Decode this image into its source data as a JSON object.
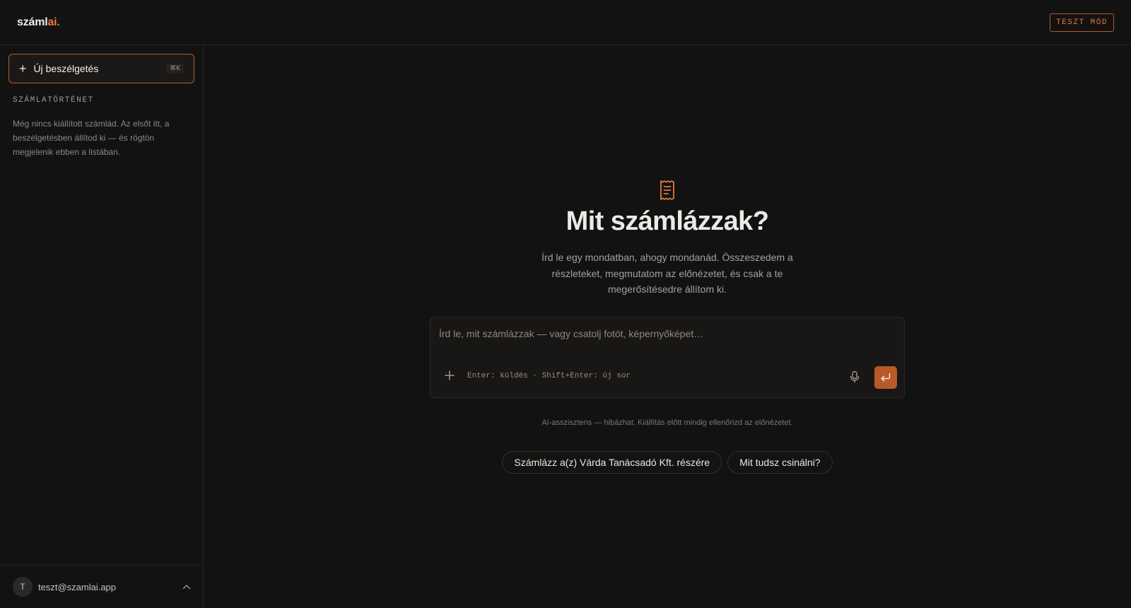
{
  "header": {
    "logo_text": "száml",
    "logo_accent": "ai.",
    "test_mode_badge": "TESZT MÓD"
  },
  "sidebar": {
    "new_chat_label": "Új beszélgetés",
    "new_chat_shortcut": "⌘K",
    "history_title": "SZÁMLATÖRTÉNET",
    "history_empty_text": "Még nincs kiállított számlád. Az elsőt itt, a beszélgetésben állítod ki — és rögtön megjelenik ebben a listában.",
    "user": {
      "avatar_initial": "T",
      "email": "teszt@szamlai.app"
    }
  },
  "main": {
    "icon": "receipt-icon",
    "headline": "Mit számlázzak?",
    "subtitle": "Írd le egy mondatban, ahogy mondanád. Összeszedem a részleteket, megmutatom az előnézetet, és csak a te megerősítésedre állítom ki.",
    "composer": {
      "value": "",
      "placeholder": "Írd le, mit számlázzak — vagy csatolj fotót, képernyőképet…",
      "hint": "Enter: küldés · Shift+Enter: új sor"
    },
    "disclaimer": "AI-asszisztens — hibázhat. Kiállítás előtt mindig ellenőrizd az előnézetet.",
    "suggestions": [
      {
        "label": "Számlázz a(z) Várda Tanácsadó Kft. részére"
      },
      {
        "label": "Mit tudsz csinálni?"
      }
    ]
  },
  "colors": {
    "accent": "#e5793a",
    "accent_dark": "#b85a28",
    "background": "#121212"
  }
}
